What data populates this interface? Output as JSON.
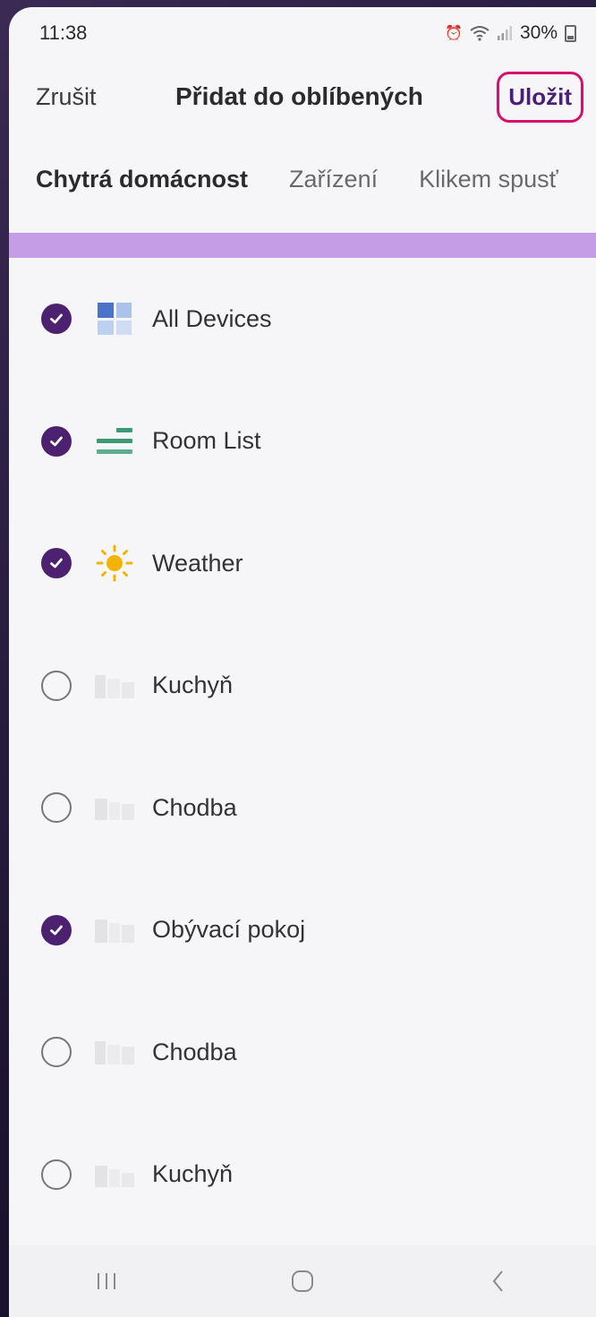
{
  "status": {
    "time": "11:38",
    "battery": "30%"
  },
  "header": {
    "cancel_label": "Zrušit",
    "title": "Přidat do oblíbených",
    "save_label": "Uložit"
  },
  "tabs": [
    {
      "label": "Chytrá domácnost",
      "active": true
    },
    {
      "label": "Zařízení",
      "active": false
    },
    {
      "label": "Klikem spusť",
      "active": false
    }
  ],
  "items": [
    {
      "label": "All Devices",
      "checked": true,
      "icon": "grid-icon"
    },
    {
      "label": "Room List",
      "checked": true,
      "icon": "room-list-icon"
    },
    {
      "label": "Weather",
      "checked": true,
      "icon": "sun-icon"
    },
    {
      "label": "Kuchyň",
      "checked": false,
      "icon": "room-thumbnail-icon"
    },
    {
      "label": "Chodba",
      "checked": false,
      "icon": "room-thumbnail-icon"
    },
    {
      "label": "Obývací pokoj",
      "checked": true,
      "icon": "room-thumbnail-icon"
    },
    {
      "label": "Chodba",
      "checked": false,
      "icon": "room-thumbnail-icon"
    },
    {
      "label": "Kuchyň",
      "checked": false,
      "icon": "room-thumbnail-icon"
    }
  ],
  "colors": {
    "accent": "#4b2170",
    "highlight": "#d4126d",
    "tab_indicator": "#c59ce6"
  }
}
